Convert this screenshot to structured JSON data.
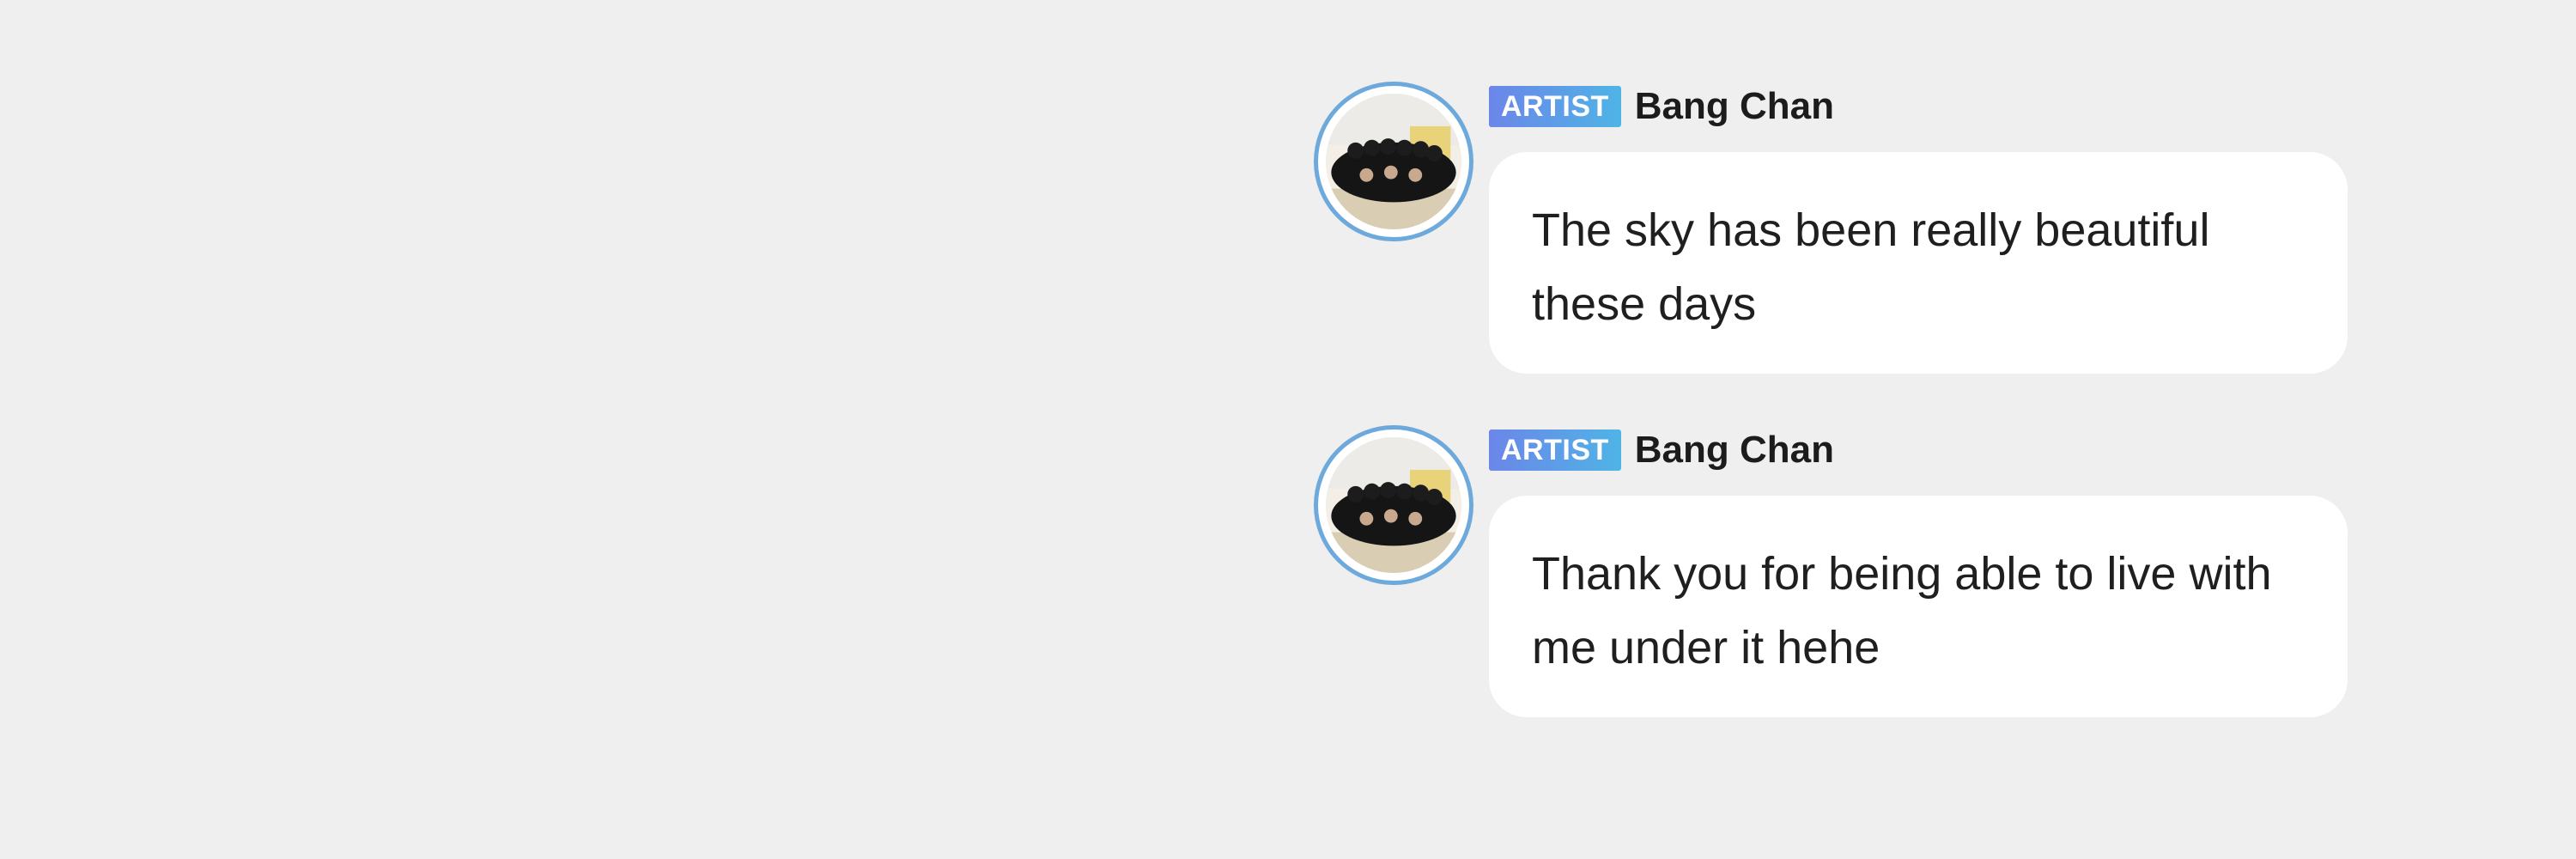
{
  "messages": [
    {
      "badge": "ARTIST",
      "author": "Bang Chan",
      "avatar_icon": "group-photo-avatar",
      "text": "The sky has been really beautiful these days"
    },
    {
      "badge": "ARTIST",
      "author": "Bang Chan",
      "avatar_icon": "group-photo-avatar",
      "text": "Thank you for being able to live with me under it hehe"
    }
  ],
  "colors": {
    "background": "#efefef",
    "bubble": "#ffffff",
    "badge_start": "#6b86e8",
    "badge_end": "#4fb4e6",
    "avatar_ring": "#6ea9dc",
    "text": "#1f1f1f"
  }
}
